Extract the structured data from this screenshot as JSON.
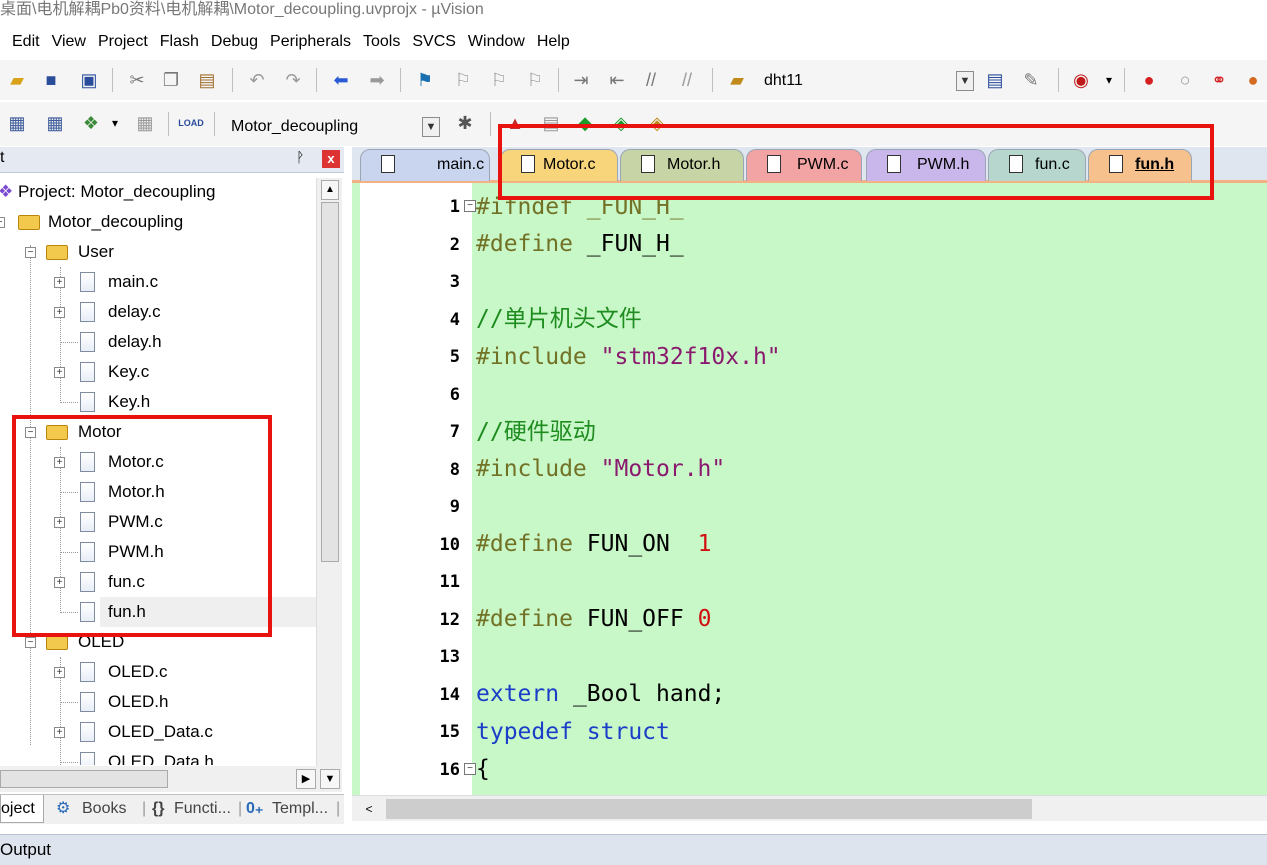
{
  "window": {
    "title": "桌面\\电机解耦Pb0资料\\电机解耦\\Motor_decoupling.uvprojx - µVision"
  },
  "menu": [
    "Edit",
    "View",
    "Project",
    "Flash",
    "Debug",
    "Peripherals",
    "Tools",
    "SVCS",
    "Window",
    "Help"
  ],
  "toolbar": {
    "find_target": "dht11",
    "target_name": "Motor_decoupling",
    "load_label": "LOAD"
  },
  "project_panel": {
    "header": "t",
    "pin": "ᚹ",
    "close": "x",
    "tree": {
      "project": "Project: Motor_decoupling",
      "target": "Motor_decoupling",
      "groups": [
        {
          "name": "User",
          "files": [
            "main.c",
            "delay.c",
            "delay.h",
            "Key.c",
            "Key.h"
          ]
        },
        {
          "name": "Motor",
          "files": [
            "Motor.c",
            "Motor.h",
            "PWM.c",
            "PWM.h",
            "fun.c",
            "fun.h"
          ]
        },
        {
          "name": "OLED",
          "files": [
            "OLED.c",
            "OLED.h",
            "OLED_Data.c",
            "OLED_Data.h"
          ]
        }
      ]
    },
    "tabs": [
      "oject",
      "Books",
      "Functi...",
      "Templ..."
    ]
  },
  "editor": {
    "tabs": [
      {
        "label": "main.c",
        "color": "#c9d4ee"
      },
      {
        "label": "Motor.c",
        "color": "#f8d47a"
      },
      {
        "label": "Motor.h",
        "color": "#c7d4a6"
      },
      {
        "label": "PWM.c",
        "color": "#f2a3a3"
      },
      {
        "label": "PWM.h",
        "color": "#c9b6ea"
      },
      {
        "label": "fun.c",
        "color": "#b7d6cd"
      },
      {
        "label": "fun.h",
        "color": "#f7c18d"
      }
    ],
    "active_tab": "fun.h",
    "line_numbers": [
      "1",
      "2",
      "3",
      "4",
      "5",
      "6",
      "7",
      "8",
      "9",
      "10",
      "11",
      "12",
      "13",
      "14",
      "15",
      "16"
    ],
    "code": {
      "l1": "#ifndef _FUN_H_",
      "l2a": "#define ",
      "l2b": "_FUN_H_",
      "l4": "//单片机头文件",
      "l5a": "#include ",
      "l5b": "\"stm32f10x.h\"",
      "l7": "//硬件驱动",
      "l8a": "#include ",
      "l8b": "\"Motor.h\"",
      "l10a": "#define ",
      "l10b": "FUN_ON  ",
      "l10c": "1",
      "l12a": "#define ",
      "l12b": "FUN_OFF ",
      "l12c": "0",
      "l14a": "extern",
      "l14b": " _Bool hand;",
      "l15a": "typedef",
      "l15b": " ",
      "l15c": "struct",
      "l16": "{"
    }
  },
  "output": {
    "label": "Output"
  },
  "colors": {
    "editor_bg": "#c8f7c8",
    "highlight": "#e8130e"
  }
}
